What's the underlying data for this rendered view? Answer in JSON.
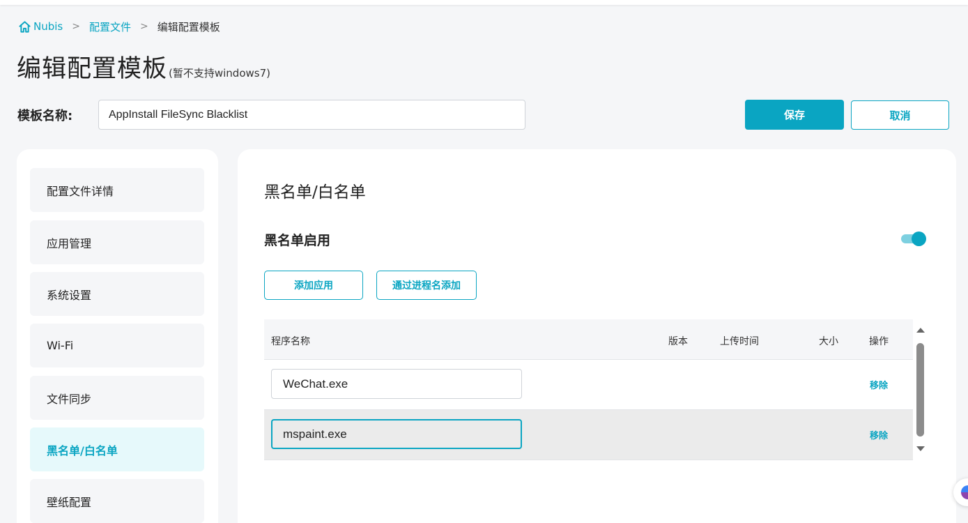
{
  "breadcrumb": {
    "home": "Nubis",
    "profiles": "配置文件",
    "current": "编辑配置模板",
    "separator": ">"
  },
  "page_title": {
    "main": "编辑配置模板",
    "note": "(暂不支持windows7)"
  },
  "template_name": {
    "label": "模板名称:",
    "value": "AppInstall FileSync Blacklist"
  },
  "actions": {
    "save": "保存",
    "cancel": "取消"
  },
  "sidebar": {
    "items": [
      {
        "label": "配置文件详情",
        "active": false
      },
      {
        "label": "应用管理",
        "active": false
      },
      {
        "label": "系统设置",
        "active": false
      },
      {
        "label": "Wi-Fi",
        "active": false
      },
      {
        "label": "文件同步",
        "active": false
      },
      {
        "label": "黑名单/白名单",
        "active": true
      },
      {
        "label": "壁纸配置",
        "active": false
      }
    ]
  },
  "main": {
    "section_title": "黑名单/白名单",
    "toggle_label": "黑名单启用",
    "toggle_on": true,
    "add_app": "添加应用",
    "add_by_process": "通过进程名添加",
    "table": {
      "columns": {
        "name": "程序名称",
        "version": "版本",
        "upload_time": "上传时间",
        "size": "大小",
        "action": "操作"
      },
      "rows": [
        {
          "name": "WeChat.exe",
          "action": "移除"
        },
        {
          "name": "mspaint.exe",
          "action": "移除"
        }
      ]
    }
  },
  "colors": {
    "accent": "#0aa5c2",
    "active_bg": "#e6f9fb",
    "page_bg": "#f5f6f8"
  }
}
